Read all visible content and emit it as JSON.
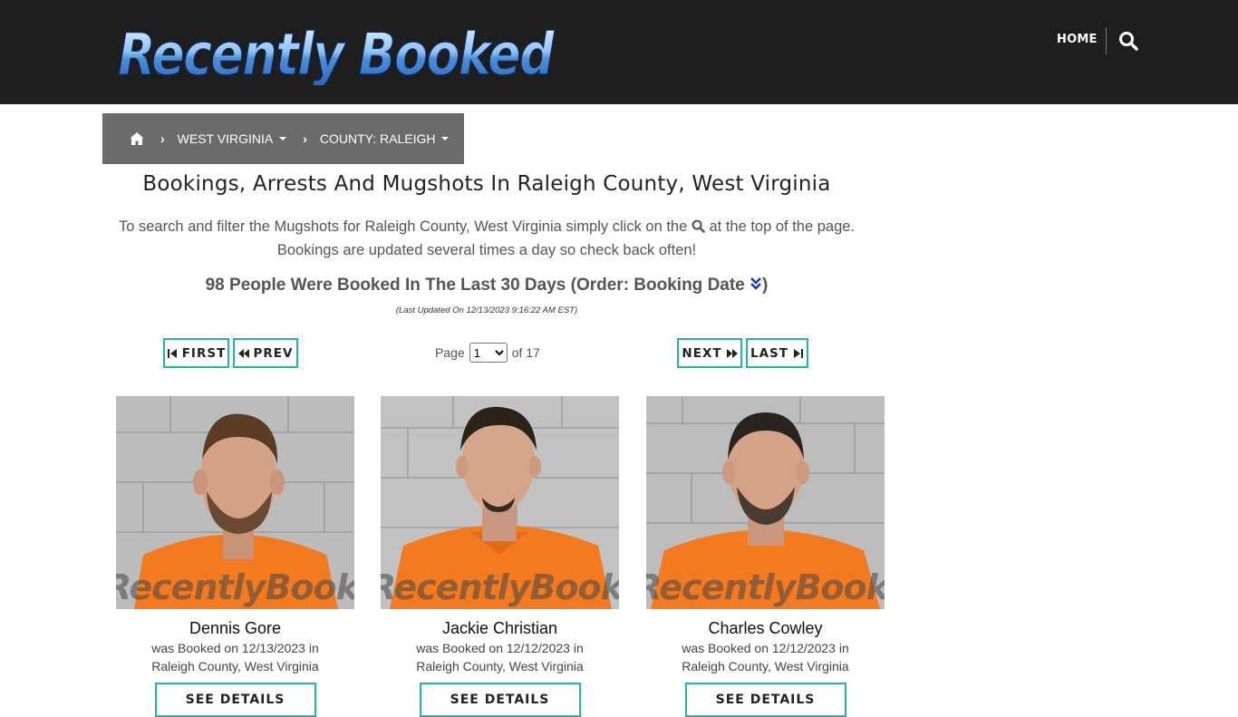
{
  "header": {
    "logo_text": "Recently Booked",
    "nav_home": "HOME",
    "search_icon": "search-icon"
  },
  "breadcrumb": {
    "home_icon": "home-icon",
    "state": "WEST VIRGINIA",
    "county": "COUNTY: RALEIGH"
  },
  "main": {
    "title": "Bookings, Arrests And Mugshots In Raleigh County, West Virginia",
    "intro_before_icon": "To search and filter the Mugshots for Raleigh County, West Virginia simply click on the",
    "intro_after_icon": "at the top of the page.",
    "intro_line2": "Bookings are updated several times a day so check back often!",
    "count_text": "98 People Were Booked In The Last 30 Days (Order: Booking Date",
    "count_close": ")",
    "updated": "(Last Updated On 12/13/2023 9:16:22 AM EST)"
  },
  "pager": {
    "first": "FIRST",
    "prev": "PREV",
    "next": "NEXT",
    "last": "LAST",
    "page_label": "Page",
    "current_page": "1",
    "of_label": "of 17"
  },
  "watermark": "RecentlyBooked.com",
  "cards": [
    {
      "name": "Dennis Gore",
      "line1": "was Booked on 12/13/2023 in",
      "line2": "Raleigh County, West Virginia",
      "button": "SEE DETAILS"
    },
    {
      "name": "Jackie Christian",
      "line1": "was Booked on 12/12/2023 in",
      "line2": "Raleigh County, West Virginia",
      "button": "SEE DETAILS"
    },
    {
      "name": "Charles Cowley",
      "line1": "was Booked on 12/12/2023 in",
      "line2": "Raleigh County, West Virginia",
      "button": "SEE DETAILS"
    }
  ],
  "colors": {
    "header_bg": "#1e1e1e",
    "breadcrumb_bg": "#6b6b6b",
    "accent_teal": "#1fb5ad",
    "uniform_orange": "#f47a1f"
  }
}
